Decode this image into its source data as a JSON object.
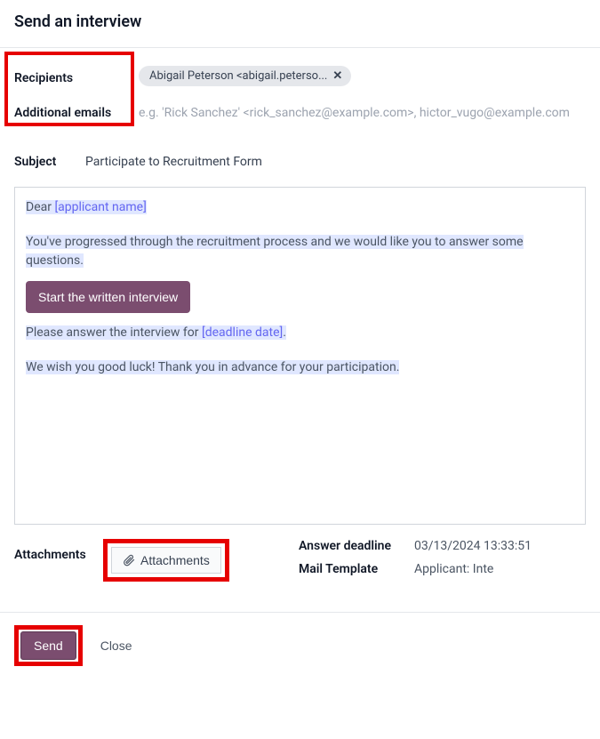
{
  "header": {
    "title": "Send an interview"
  },
  "fields": {
    "recipients_label": "Recipients",
    "recipient_tag": "Abigail Peterson <abigail.peterso...",
    "additional_label": "Additional emails",
    "additional_placeholder": "e.g.  'Rick Sanchez' <rick_sanchez@example.com>, hictor_vugo@example.com",
    "subject_label": "Subject",
    "subject_value": "Participate to Recruitment Form"
  },
  "body": {
    "line1_prefix": "Dear ",
    "line1_token": "[applicant name]",
    "line2": "You've progressed through the recruitment process and we would like you to answer some questions.",
    "cta": "Start the written interview",
    "line3_prefix": "Please answer the interview for ",
    "line3_token": "[deadline date]",
    "line3_suffix": ".",
    "line4": "We wish you good luck! Thank you in advance for your participation."
  },
  "attachments": {
    "label": "Attachments",
    "button": "Attachments"
  },
  "meta": {
    "deadline_label": "Answer deadline",
    "deadline_value": "03/13/2024 13:33:51",
    "template_label": "Mail Template",
    "template_value": "Applicant: Inte"
  },
  "footer": {
    "send": "Send",
    "close": "Close"
  }
}
